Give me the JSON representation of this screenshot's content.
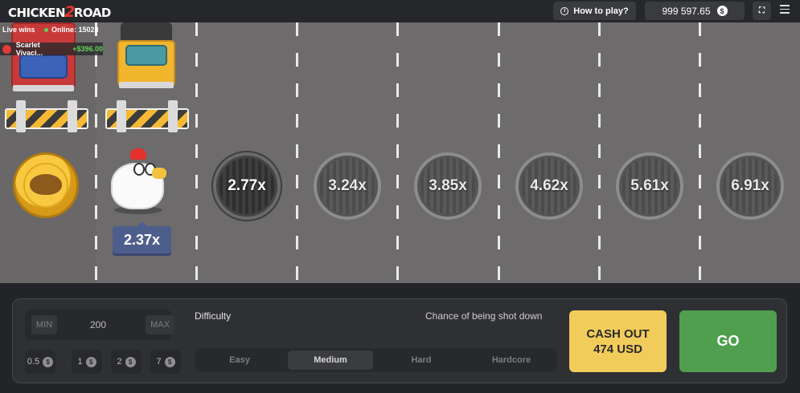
{
  "header": {
    "logo_part1": "CHICKEN",
    "logo_part2": "2",
    "logo_part3": "ROAD",
    "how_to_play": "How to play?",
    "balance": "999 597.65",
    "currency_symbol": "$"
  },
  "live": {
    "live_wins_label": "Live wins",
    "online_label": "Online: 15028",
    "winner_name": "Scarlet Vivaci...",
    "winner_amount": "+$396.00"
  },
  "game": {
    "current_multiplier": "2.37x",
    "lanes": [
      "2.77x",
      "3.24x",
      "3.85x",
      "4.62x",
      "5.61x",
      "6.91x"
    ]
  },
  "controls": {
    "min_label": "MIN",
    "bet_value": "200",
    "max_label": "MAX",
    "chips": [
      "0.5",
      "1",
      "2",
      "7"
    ],
    "chip_currency": "$",
    "difficulty_label": "Difficulty",
    "chance_label": "Chance of being shot down",
    "difficulties": [
      "Easy",
      "Medium",
      "Hard",
      "Hardcore"
    ],
    "selected_difficulty": "Medium",
    "cashout_line1": "CASH OUT",
    "cashout_line2": "474 USD",
    "go_label": "GO"
  },
  "colors": {
    "road": "#6d6b6c",
    "cashout": "#f2cc5b",
    "go": "#4f9f4e",
    "multiplier_badge": "#4e5e8c"
  }
}
